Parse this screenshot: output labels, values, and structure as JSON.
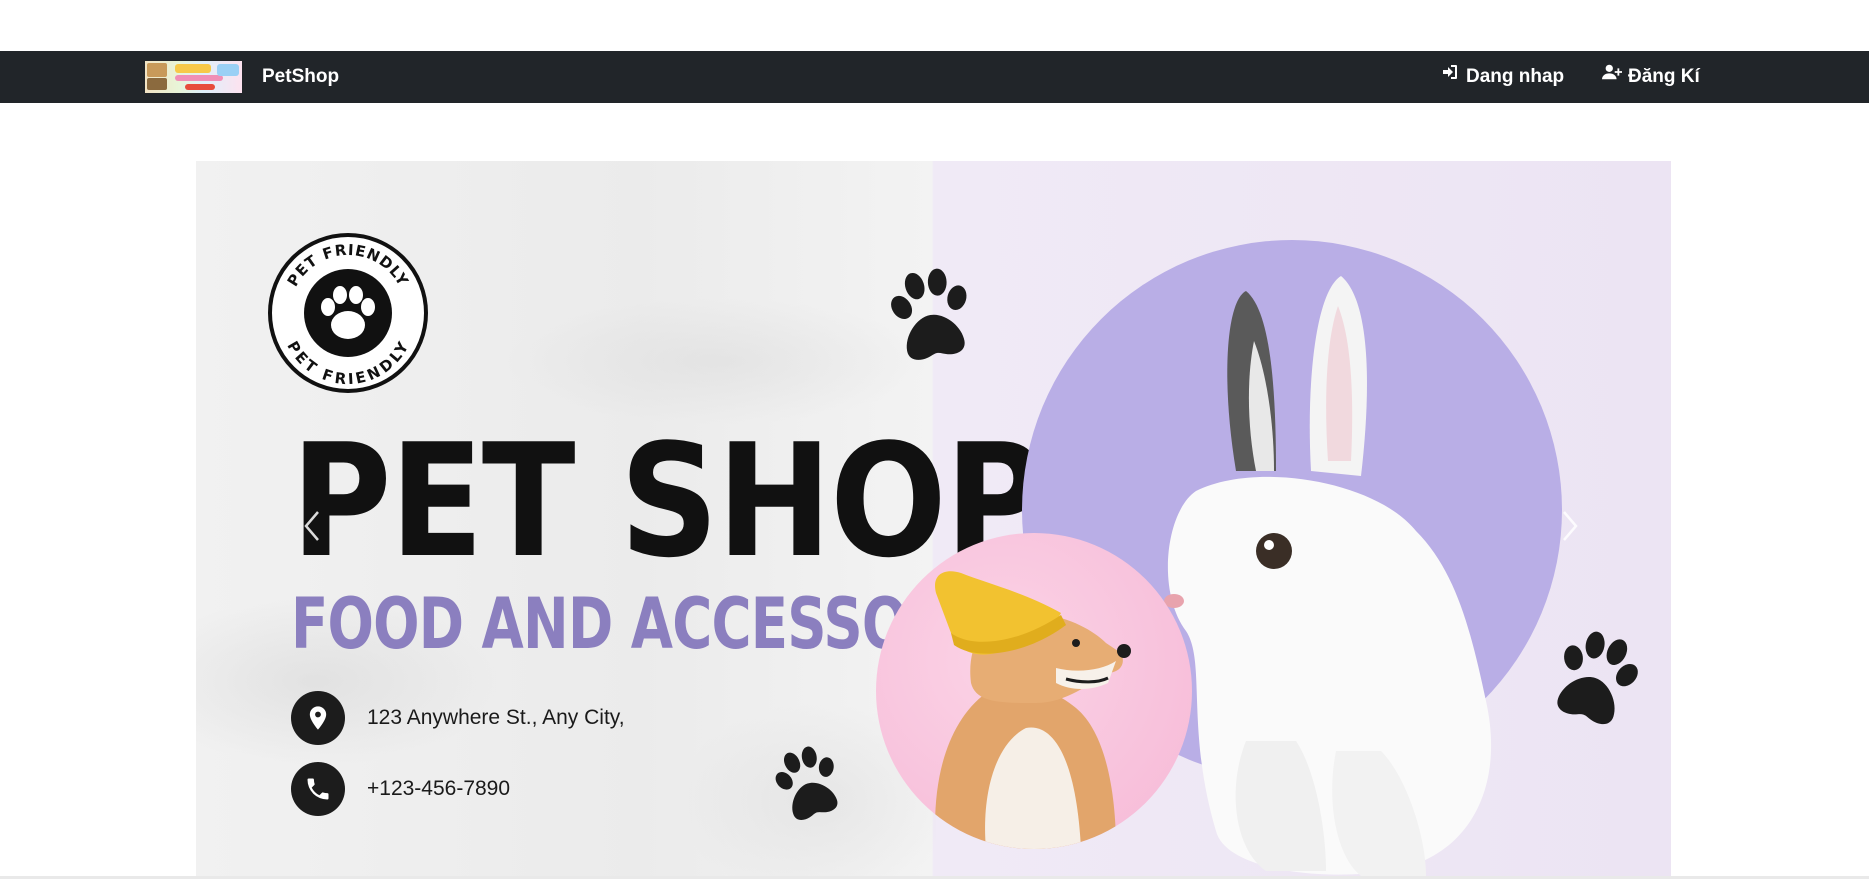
{
  "navbar": {
    "brand_name": "PetShop",
    "login_label": "Dang nhap",
    "register_label": "Đăng Kí",
    "background": "#212529",
    "text_color": "#ffffff"
  },
  "banner": {
    "seal_text_top": "PET FRIENDLY",
    "seal_text_bottom": "PET FRIENDLY",
    "title": "PET SHOP",
    "subtitle": "FOOD AND ACCESSORIES",
    "address": "123 Anywhere St., Any City,",
    "phone": "+123-456-7890",
    "colors": {
      "subtitle": "#8b7fbf",
      "big_circle": "#b9aee6",
      "small_circle": "#f6b8d6",
      "paw": "#1c1c1c"
    }
  },
  "icons": {
    "login": "sign-in-icon",
    "register": "user-plus-icon",
    "address": "map-marker-icon",
    "phone": "phone-icon",
    "carousel_prev": "chevron-left-icon",
    "carousel_next": "chevron-right-icon"
  }
}
